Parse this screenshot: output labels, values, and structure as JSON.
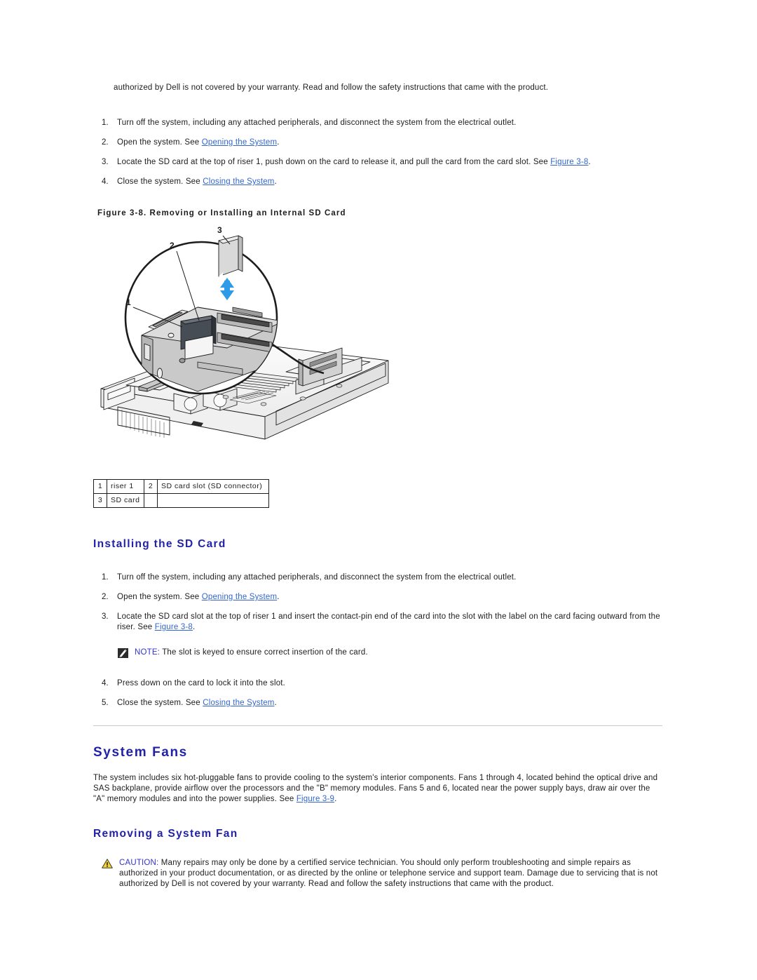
{
  "document": {
    "top_continuation_text": "authorized by Dell is not covered by your warranty. Read and follow the safety instructions that came with the product."
  },
  "removing_sd_card": {
    "steps": [
      {
        "num": "1.",
        "text_before": "Turn off the system, including any attached peripherals, and disconnect the system from the electrical outlet.",
        "link": "",
        "text_after": ""
      },
      {
        "num": "2.",
        "text_before": "Open the system. See ",
        "link": "Opening the System",
        "text_after": "."
      },
      {
        "num": "3.",
        "text_before": "Locate the SD card at the top of riser 1, push down on the card to release it, and pull the card from the card slot. See ",
        "link": "Figure 3-8",
        "text_after": "."
      },
      {
        "num": "4.",
        "text_before": "Close the system. See ",
        "link": "Closing the System",
        "text_after": "."
      }
    ]
  },
  "figure": {
    "caption": "Figure 3-8. Removing or Installing an Internal SD Card",
    "callouts": [
      {
        "id": "1",
        "label": "riser 1"
      },
      {
        "id": "2",
        "label": "SD card slot (SD connector)"
      },
      {
        "id": "3",
        "label": "SD card"
      }
    ],
    "legend_rows": [
      {
        "num_a": "1",
        "label_a": "riser 1",
        "num_b": "2",
        "label_b": "SD card slot (SD connector)"
      },
      {
        "num_a": "3",
        "label_a": "SD card",
        "num_b": "",
        "label_b": ""
      }
    ],
    "arrow_color": "#2e9be8",
    "card_color": "#d6d6d6",
    "slot_color": "#3c4148"
  },
  "installing_sd_card": {
    "heading": "Installing the SD Card",
    "steps": [
      {
        "num": "1.",
        "text_before": "Turn off the system, including any attached peripherals, and disconnect the system from the electrical outlet.",
        "link": "",
        "text_after": ""
      },
      {
        "num": "2.",
        "text_before": "Open the system. See ",
        "link": "Opening the System",
        "text_after": "."
      },
      {
        "num": "3.",
        "text_before": "Locate the SD card slot at the top of riser 1 and insert the contact-pin end of the card into the slot with the label on the card facing outward from the riser. See ",
        "link": "Figure 3-8",
        "text_after": "."
      }
    ],
    "note": {
      "keyword": "NOTE:",
      "text": " The slot is keyed to ensure correct insertion of the card.",
      "icon": "note-pencil-icon"
    },
    "steps_after_note": [
      {
        "num": "4.",
        "text_before": "Press down on the card to lock it into the slot.",
        "link": "",
        "text_after": ""
      },
      {
        "num": "5.",
        "text_before": "Close the system. See ",
        "link": "Closing the System",
        "text_after": "."
      }
    ]
  },
  "system_fans": {
    "heading": "System Fans",
    "paragraph_before": "The system includes six hot-pluggable fans to provide cooling to the system's interior components. Fans 1 through 4, located behind the optical drive and SAS backplane, provide airflow over the processors and the \"B\" memory modules. Fans 5 and 6, located near the power supply bays, draw air over the \"A\" memory modules and into the power supplies. See ",
    "paragraph_link": "Figure 3-9",
    "paragraph_after": "."
  },
  "removing_system_fan": {
    "heading": "Removing a System Fan",
    "caution": {
      "keyword": "CAUTION:",
      "text": " Many repairs may only be done by a certified service technician. You should only perform troubleshooting and simple repairs as authorized in your product documentation, or as directed by the online or telephone service and support team. Damage due to servicing that is not authorized by Dell is not covered by your warranty. Read and follow the safety instructions that came with the product.",
      "icon": "warning-triangle-icon",
      "icon_color": "#f2d23a"
    }
  },
  "colors": {
    "heading_blue": "#2222a8",
    "link_blue": "#3366cc",
    "body_text": "#1c1c1c",
    "rule_gray": "#c8c8c8"
  }
}
